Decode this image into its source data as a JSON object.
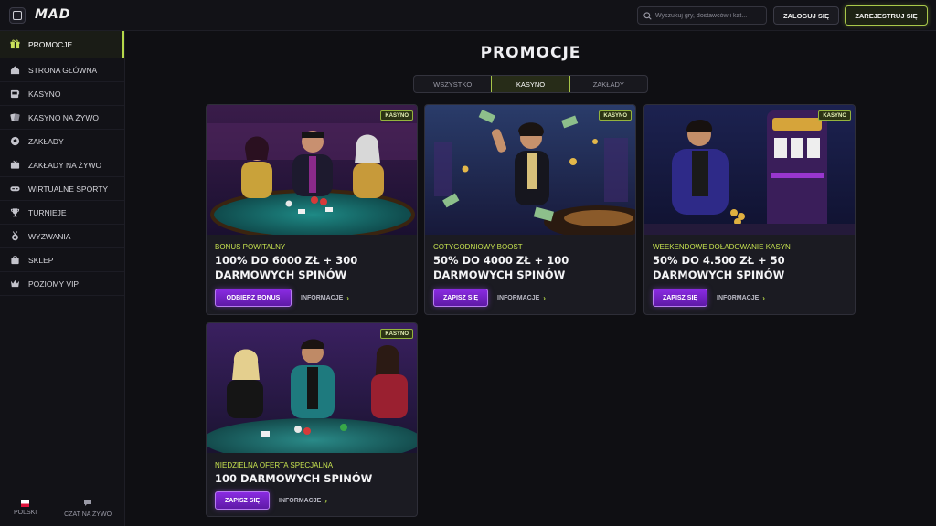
{
  "header": {
    "logo": "MAD",
    "search_placeholder": "Wyszukuj gry, dostawców i kat...",
    "login_label": "ZALOGUJ SIĘ",
    "register_label": "ZAREJESTRUJ SIĘ"
  },
  "sidebar": {
    "items": [
      {
        "label": "PROMOCJE",
        "icon": "gift-icon"
      },
      {
        "label": "STRONA GŁÓWNA",
        "icon": "home-icon"
      },
      {
        "label": "KASYNO",
        "icon": "slot-machine-icon"
      },
      {
        "label": "KASYNO NA ŻYWO",
        "icon": "cards-icon"
      },
      {
        "label": "ZAKŁADY",
        "icon": "football-icon"
      },
      {
        "label": "ZAKŁADY NA ŻYWO",
        "icon": "tv-icon"
      },
      {
        "label": "WIRTUALNE SPORTY",
        "icon": "gamepad-icon"
      },
      {
        "label": "TURNIEJE",
        "icon": "trophy-icon"
      },
      {
        "label": "WYZWANIA",
        "icon": "medal-icon"
      },
      {
        "label": "SKLEP",
        "icon": "shop-icon"
      },
      {
        "label": "POZIOMY VIP",
        "icon": "crown-icon"
      }
    ],
    "footer": {
      "language": "POLSKI",
      "chat": "CZAT NA ŻYWO"
    }
  },
  "main": {
    "title": "PROMOCJE",
    "tabs": [
      "WSZYSTKO",
      "KASYNO",
      "ZAKŁADY"
    ],
    "active_tab": "KASYNO",
    "cards": [
      {
        "badge": "KASYNO",
        "subtitle": "BONUS POWITALNY",
        "title": "100% DO 6000 ZŁ + 300 DARMOWYCH SPINÓW",
        "cta": "ODBIERZ BONUS",
        "info": "INFORMACJE"
      },
      {
        "badge": "KASYNO",
        "subtitle": "COTYGODNIOWY BOOST",
        "title": "50% DO 4000 ZŁ + 100 DARMOWYCH SPINÓW",
        "cta": "ZAPISZ SIĘ",
        "info": "INFORMACJE"
      },
      {
        "badge": "KASYNO",
        "subtitle": "WEEKENDOWE DOŁADOWANIE KASYN",
        "title": "50% DO 4.500 ZŁ + 50 DARMOWYCH SPINÓW",
        "cta": "ZAPISZ SIĘ",
        "info": "INFORMACJE"
      },
      {
        "badge": "KASYNO",
        "subtitle": "NIEDZIELNA OFERTA SPECJALNA",
        "title": "100 DARMOWYCH SPINÓW",
        "cta": "ZAPISZ SIĘ",
        "info": "INFORMACJE"
      }
    ]
  },
  "colors": {
    "accent_lime": "#b5d84a",
    "cta_purple": "#8a2be2",
    "background": "#0f0f13"
  }
}
